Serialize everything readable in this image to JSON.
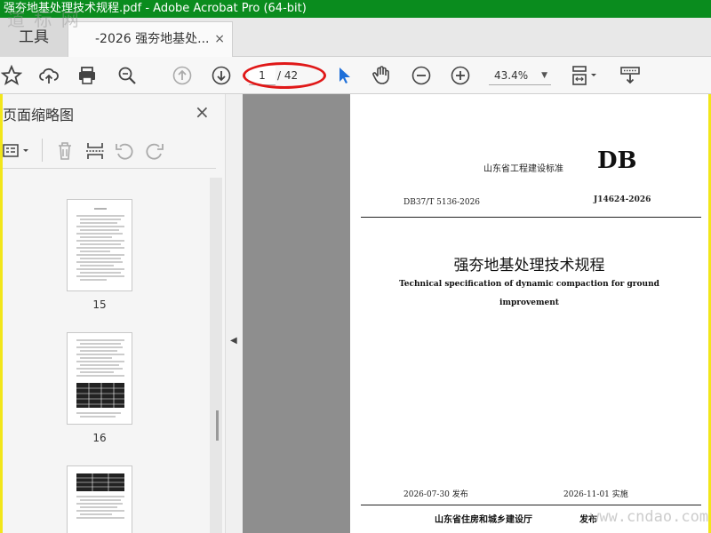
{
  "window": {
    "title": "强夯地基处理技术规程.pdf - Adobe Acrobat Pro (64-bit)"
  },
  "watermarks": {
    "top_left": "道 标 网",
    "bottom_right": "www.cndao.com"
  },
  "tabs": {
    "tools_label": "工具",
    "doc_label": "-2026 强夯地基处...",
    "close_glyph": "×"
  },
  "toolbar": {
    "icons": [
      "bookmark-star-icon",
      "upload-cloud-icon",
      "print-icon",
      "zoom-search-icon",
      "page-up-icon",
      "page-down-icon",
      "select-arrow-icon",
      "hand-tool-icon",
      "zoom-out-icon",
      "zoom-in-icon",
      "page-fit-icon",
      "scroll-mode-icon"
    ],
    "current_page": "1",
    "total_pages": "/ 42",
    "zoom": "43.4%",
    "accent_color": "#1e6fd9",
    "highlight_color": "#e01818"
  },
  "sidebar": {
    "title": "页面缩略图",
    "close_glyph": "×",
    "thumbnails": [
      {
        "label": "15"
      },
      {
        "label": "16"
      },
      {
        "label": ""
      }
    ]
  },
  "document_page": {
    "standard_name": "山东省工程建设标准",
    "db_mark": "DB",
    "code_left": "DB37/T 5136-2026",
    "code_right": "J14624-2026",
    "title_cn": "强夯地基处理技术规程",
    "title_en_line1": "Technical specification of dynamic compaction for ground",
    "title_en_line2": "improvement",
    "publish_date": "2026-07-30 发布",
    "implement_date": "2026-11-01 实施",
    "issuer": "山东省住房和城乡建设厅",
    "issue_word": "发布"
  },
  "colors": {
    "titlebar": "#0a8c1e",
    "frame": "#f2e61a",
    "viewer_bg": "#8e8e8e"
  }
}
